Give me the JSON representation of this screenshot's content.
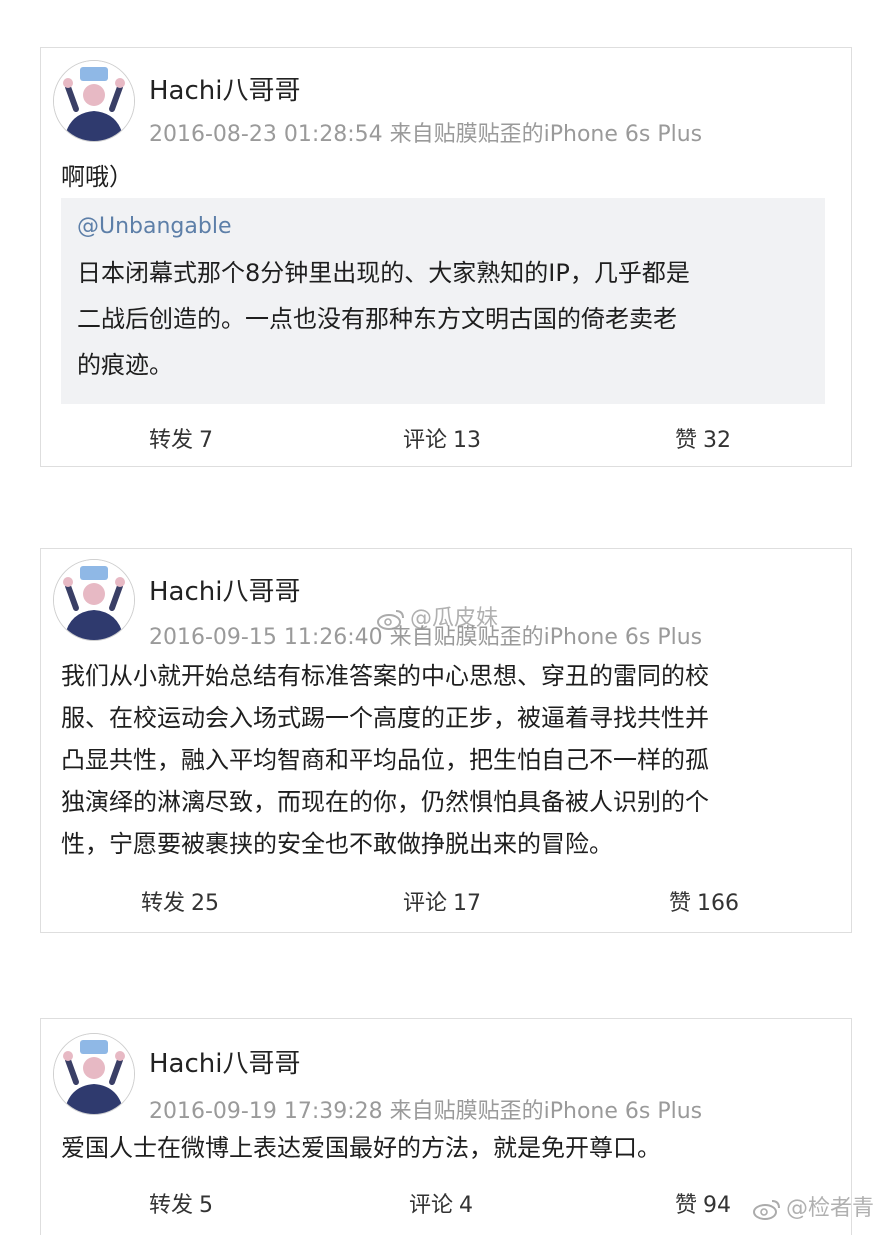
{
  "posts": [
    {
      "username": "Hachi八哥哥",
      "meta": "2016-08-23 01:28:54  来自贴膜贴歪的iPhone 6s Plus",
      "text": "啊哦）",
      "quote": {
        "mention": "@Unbangable",
        "lines": [
          "日本闭幕式那个8分钟里出现的、大家熟知的IP，几乎都是",
          "二战后创造的。一点也没有那种东方文明古国的倚老卖老",
          "的痕迹。"
        ]
      },
      "actions": {
        "repost_label": "转发",
        "repost_count": "7",
        "comment_label": "评论",
        "comment_count": "13",
        "like_label": "赞",
        "like_count": "32"
      }
    },
    {
      "username": "Hachi八哥哥",
      "meta": "2016-09-15 11:26:40  来自贴膜贴歪的iPhone 6s Plus",
      "lines": [
        "我们从小就开始总结有标准答案的中心思想、穿丑的雷同的校",
        "服、在校运动会入场式踢一个高度的正步，被逼着寻找共性并",
        "凸显共性，融入平均智商和平均品位，把生怕自己不一样的孤",
        "独演绎的淋漓尽致，而现在的你，仍然惧怕具备被人识别的个",
        "性，宁愿要被裹挟的安全也不敢做挣脱出来的冒险。"
      ],
      "actions": {
        "repost_label": "转发",
        "repost_count": "25",
        "comment_label": "评论",
        "comment_count": "17",
        "like_label": "赞",
        "like_count": "166"
      }
    },
    {
      "username": "Hachi八哥哥",
      "meta": "2016-09-19 17:39:28  来自贴膜贴歪的iPhone 6s Plus",
      "text": "爱国人士在微博上表达爱国最好的方法，就是免开尊口。",
      "actions": {
        "repost_label": "转发",
        "repost_count": "5",
        "comment_label": "评论",
        "comment_count": "4",
        "like_label": "赞",
        "like_count": "94"
      }
    }
  ],
  "watermarks": {
    "mid": "@瓜皮妹",
    "bottom": "@检者青"
  },
  "colors": {
    "mention": "#5d7fa8",
    "meta": "#9a9a9a",
    "quote_bg": "#f1f2f4",
    "border": "#dedede"
  }
}
